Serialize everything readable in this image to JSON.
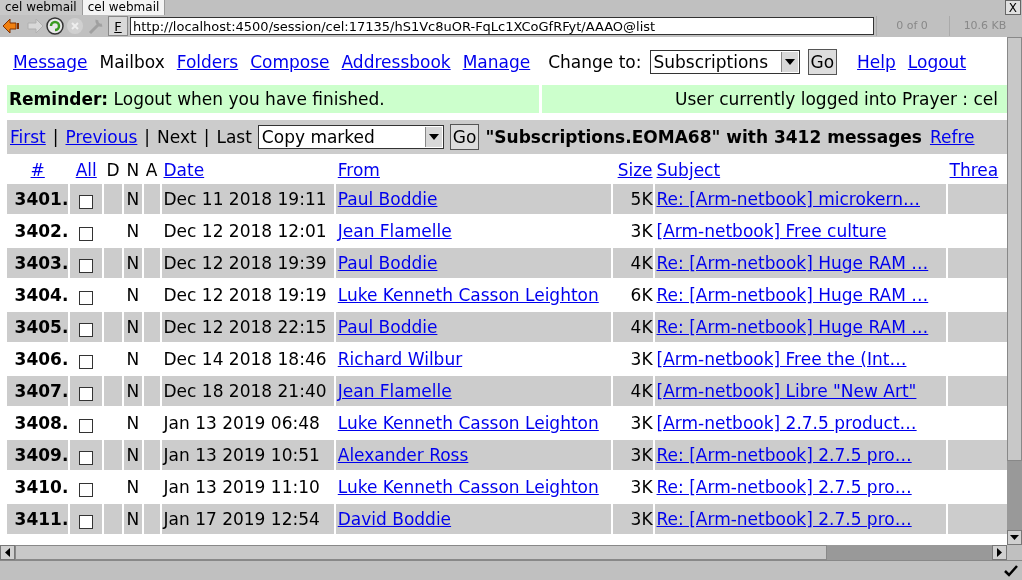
{
  "browser": {
    "tabs": [
      {
        "label": "cel webmail",
        "selected": false
      },
      {
        "label": "cel webmail",
        "selected": true
      }
    ],
    "close": "X",
    "find_button": "F",
    "url": "http://localhost:4500/session/cel:17135/hS1Vc8uOR-FqLc1XCoGfRFyt/AAAO@list",
    "match_count": "0 of 0",
    "page_size": "10.6 KB"
  },
  "nav": {
    "links": [
      {
        "label": "Message",
        "kind": "link"
      },
      {
        "label": "Mailbox",
        "kind": "text"
      },
      {
        "label": "Folders",
        "kind": "link"
      },
      {
        "label": "Compose",
        "kind": "link"
      },
      {
        "label": "Addressbook",
        "kind": "link"
      },
      {
        "label": "Manage",
        "kind": "link"
      }
    ],
    "change_to_label": "Change to:",
    "change_to_value": "Subscriptions",
    "go": "Go",
    "help": "Help",
    "logout": "Logout"
  },
  "reminder": {
    "text": "**Reminder:** Logout when you have finished.",
    "user": "User currently logged into Prayer : cel"
  },
  "pager": {
    "items": [
      {
        "label": "First",
        "kind": "link"
      },
      {
        "label": "|",
        "kind": "separator"
      },
      {
        "label": "Previous",
        "kind": "link"
      },
      {
        "label": "|",
        "kind": "separator"
      },
      {
        "label": "Next",
        "kind": "text"
      },
      {
        "label": "|",
        "kind": "separator"
      },
      {
        "label": "Last",
        "kind": "text"
      }
    ],
    "action": "Copy marked",
    "go": "Go",
    "title": "\"Subscriptions.EOMA68\" with 3412 messages",
    "refresh": "Refre"
  },
  "table": {
    "columns": [
      {
        "label": "#",
        "kind": "link"
      },
      {
        "label": "All",
        "kind": "link"
      },
      {
        "label": "D",
        "kind": "text"
      },
      {
        "label": "N",
        "kind": "text"
      },
      {
        "label": "A",
        "kind": "text"
      },
      {
        "label": "Date",
        "kind": "link"
      },
      {
        "label": "From",
        "kind": "link"
      },
      {
        "label": "Size",
        "kind": "link"
      },
      {
        "label": "Subject",
        "kind": "link"
      },
      {
        "label": "Threa",
        "kind": "link"
      }
    ],
    "rows": [
      {
        "num": "3401.",
        "marked": false,
        "n": "N",
        "date": "Dec 11 2018 19:11",
        "from": "Paul Boddie",
        "size": "5K",
        "subject": "Re: [Arm-netbook] microkern…"
      },
      {
        "num": "3402.",
        "marked": false,
        "n": "N",
        "date": "Dec 12 2018 12:01",
        "from": "Jean Flamelle",
        "size": "3K",
        "subject": "[Arm-netbook] Free culture"
      },
      {
        "num": "3403.",
        "marked": false,
        "n": "N",
        "date": "Dec 12 2018 19:39",
        "from": "Paul Boddie",
        "size": "4K",
        "subject": "Re: [Arm-netbook] Huge RAM …"
      },
      {
        "num": "3404.",
        "marked": false,
        "n": "N",
        "date": "Dec 12 2018 19:19",
        "from": "Luke Kenneth Casson Leighton",
        "size": "6K",
        "subject": "Re: [Arm-netbook] Huge RAM …"
      },
      {
        "num": "3405.",
        "marked": false,
        "n": "N",
        "date": "Dec 12 2018 22:15",
        "from": "Paul Boddie",
        "size": "4K",
        "subject": "Re: [Arm-netbook] Huge RAM …"
      },
      {
        "num": "3406.",
        "marked": false,
        "n": "N",
        "date": "Dec 14 2018 18:46",
        "from": "Richard Wilbur",
        "size": "3K",
        "subject": "[Arm-netbook] Free the (Int…"
      },
      {
        "num": "3407.",
        "marked": false,
        "n": "N",
        "date": "Dec 18 2018 21:40",
        "from": "Jean Flamelle",
        "size": "4K",
        "subject": "[Arm-netbook] Libre \"New Art\""
      },
      {
        "num": "3408.",
        "marked": false,
        "n": "N",
        "date": "Jan 13 2019 06:48",
        "from": "Luke Kenneth Casson Leighton",
        "size": "3K",
        "subject": "[Arm-netbook] 2.7.5 product…"
      },
      {
        "num": "3409.",
        "marked": false,
        "n": "N",
        "date": "Jan 13 2019 10:51",
        "from": "Alexander Ross",
        "size": "3K",
        "subject": "Re: [Arm-netbook] 2.7.5 pro…"
      },
      {
        "num": "3410.",
        "marked": false,
        "n": "N",
        "date": "Jan 13 2019 11:10",
        "from": "Luke Kenneth Casson Leighton",
        "size": "3K",
        "subject": "Re: [Arm-netbook] 2.7.5 pro…"
      },
      {
        "num": "3411.",
        "marked": false,
        "n": "N",
        "date": "Jan 17 2019 12:54",
        "from": "David Boddie",
        "size": "3K",
        "subject": "Re: [Arm-netbook] 2.7.5 pro…"
      }
    ]
  }
}
